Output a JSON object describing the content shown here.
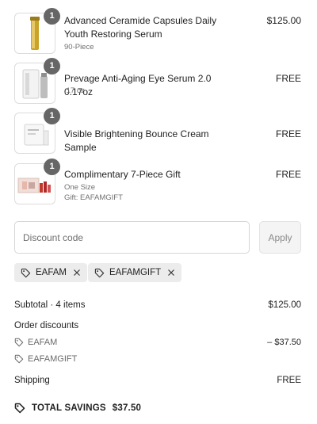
{
  "items": [
    {
      "quantity": "1",
      "name": "Advanced Ceramide Capsules Daily Youth Restoring Serum",
      "details": [
        "90-Piece"
      ],
      "price": "$125.00"
    },
    {
      "quantity": "1",
      "name": "Prevage Anti-Aging Eye Serum 2.0 0.17oz",
      "details": [
        ".17 oz"
      ],
      "price": "FREE"
    },
    {
      "quantity": "1",
      "name": "Visible Brightening Bounce Cream Sample",
      "details": [],
      "price": "FREE"
    },
    {
      "quantity": "1",
      "name": "Complimentary 7-Piece Gift",
      "details": [
        "One Size",
        "Gift: EAFAMGIFT"
      ],
      "price": "FREE"
    }
  ],
  "discount": {
    "placeholder": "Discount code",
    "value": "",
    "apply_label": "Apply"
  },
  "applied_codes": [
    "EAFAM",
    "EAFAMGIFT"
  ],
  "summary": {
    "subtotal_label": "Subtotal · 4 items",
    "subtotal_value": "$125.00",
    "order_discounts_label": "Order discounts",
    "discount_lines": [
      {
        "code": "EAFAM",
        "amount": "– $37.50"
      },
      {
        "code": "EAFAMGIFT",
        "amount": ""
      }
    ],
    "shipping_label": "Shipping",
    "shipping_value": "FREE",
    "total_savings_label": "TOTAL SAVINGS",
    "total_savings_value": "$37.50"
  },
  "icons": {
    "tag": "tag-icon",
    "remove": "close-icon"
  },
  "colors": {
    "badge": "#666666",
    "chip_bg": "#ececec",
    "muted_text": "#707070"
  }
}
